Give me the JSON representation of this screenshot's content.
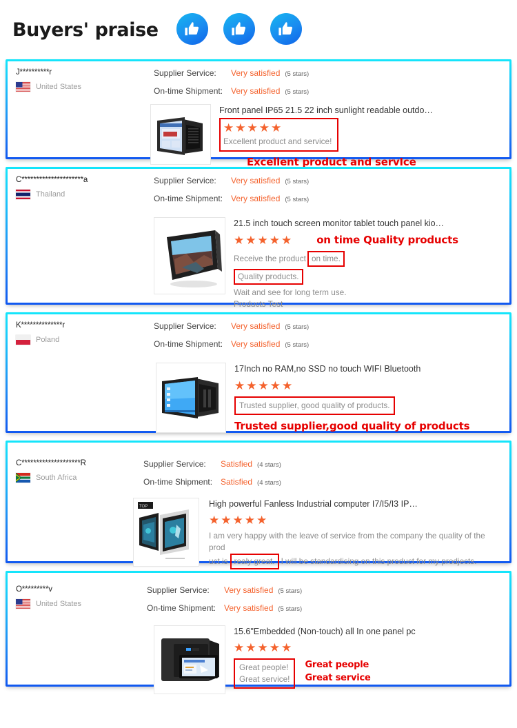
{
  "header": {
    "title": "Buyers' praise",
    "badges": [
      "thumbs-up-icon",
      "thumbs-up-icon",
      "thumbs-up-icon"
    ],
    "accent_cyan": "#15e6fb",
    "accent_blue": "#1158f0"
  },
  "labels": {
    "supplier_service": "Supplier Service:",
    "on_time_shipment": "On-time Shipment:"
  },
  "colors": {
    "rating_orange": "#f4622d",
    "annotation_red": "#e60000",
    "comment_grey": "#8c8c8c"
  },
  "reviews": [
    {
      "buyer": "J**********r",
      "country": "United States",
      "flag": "flag-us",
      "supplier_service": "Very satisfied",
      "supplier_service_stars": "(5 stars)",
      "on_time_shipment": "Very satisfied",
      "on_time_shipment_stars": "(5 stars)",
      "product_title": "Front panel IP65 21.5 22 inch sunlight readable outdo…",
      "stars": "★★★★★",
      "comments": [
        "Excellent product and service!"
      ],
      "annotation": "Excellent product and servIce"
    },
    {
      "buyer": "C*********************a",
      "country": "Thailand",
      "flag": "flag-th",
      "supplier_service": "Very satisfied",
      "supplier_service_stars": "(5 stars)",
      "on_time_shipment": "Very satisfied",
      "on_time_shipment_stars": "(5 stars)",
      "product_title": "21.5 inch touch screen monitor tablet touch panel kio…",
      "stars": "★★★★★",
      "comments": [
        "Receive the product",
        "on time.",
        "Quality products.",
        "Wait and see for long term use.",
        "Products Test"
      ],
      "annotation": "on time Quality products"
    },
    {
      "buyer": "K**************r",
      "country": "Poland",
      "flag": "flag-pl",
      "supplier_service": "Very satisfied",
      "supplier_service_stars": "(5 stars)",
      "on_time_shipment": "Very satisfied",
      "on_time_shipment_stars": "(5 stars)",
      "product_title": "17Inch no RAM,no SSD no touch WIFI Bluetooth",
      "stars": "★★★★★",
      "comments": [
        "Trusted supplier, good quality of products."
      ],
      "annotation": "Trusted supplier,good quality of products"
    },
    {
      "buyer": "C********************R",
      "country": "South Africa",
      "flag": "flag-za",
      "supplier_service": "Satisfied",
      "supplier_service_stars": "(4 stars)",
      "on_time_shipment": "Satisfied",
      "on_time_shipment_stars": "(4 stars)",
      "product_title": "High powerful Fanless Industrial computer I7/I5/I3 IP…",
      "stars": "★★★★★",
      "comments": [
        "I am very happy with the leave of service from the company the quality of the prod",
        "uct is",
        "realy great.",
        "I will be standardising on this product for my prodjects."
      ],
      "annotation": "realy great"
    },
    {
      "buyer": "O*********v",
      "country": "United States",
      "flag": "flag-us",
      "supplier_service": "Very satisfied",
      "supplier_service_stars": "(5 stars)",
      "on_time_shipment": "Very satisfied",
      "on_time_shipment_stars": "(5 stars)",
      "product_title": "15.6\"Embedded (Non-touch) all In one panel pc",
      "stars": "★★★★★",
      "comments": [
        "Great people!",
        "Great service!"
      ],
      "annotation": "Great people",
      "annotation2": "Great service"
    }
  ]
}
